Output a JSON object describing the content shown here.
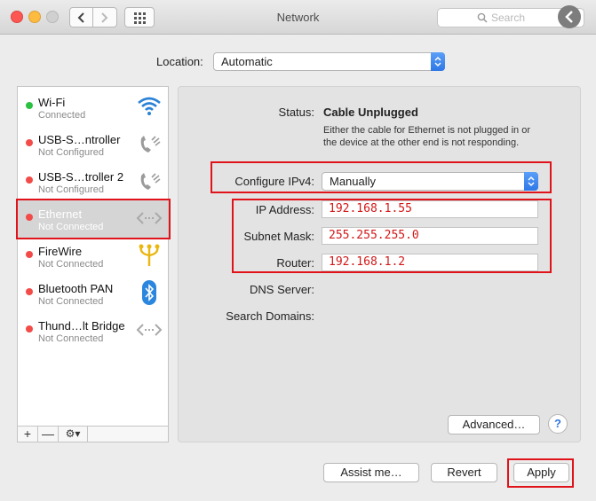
{
  "window": {
    "title": "Network"
  },
  "search": {
    "placeholder": "Search"
  },
  "location": {
    "label": "Location:",
    "value": "Automatic"
  },
  "services": [
    {
      "name": "Wi-Fi",
      "status": "Connected",
      "dot": "#2bc140",
      "icon": "wifi-icon"
    },
    {
      "name": "USB-S…ntroller",
      "status": "Not Configured",
      "dot": "#f24b48",
      "icon": "phone-icon"
    },
    {
      "name": "USB-S…troller 2",
      "status": "Not Configured",
      "dot": "#f24b48",
      "icon": "phone-icon"
    },
    {
      "name": "Ethernet",
      "status": "Not Connected",
      "dot": "#f24b48",
      "icon": "ethernet-icon"
    },
    {
      "name": "FireWire",
      "status": "Not Connected",
      "dot": "#f24b48",
      "icon": "firewire-icon"
    },
    {
      "name": "Bluetooth PAN",
      "status": "Not Connected",
      "dot": "#f24b48",
      "icon": "bluetooth-icon"
    },
    {
      "name": "Thund…lt Bridge",
      "status": "Not Connected",
      "dot": "#f24b48",
      "icon": "ethernet-icon"
    }
  ],
  "sidebar_footer": {
    "add": "+",
    "remove": "—",
    "gear": "⚙▾"
  },
  "detail": {
    "status_label": "Status:",
    "status_value": "Cable Unplugged",
    "status_description": "Either the cable for Ethernet is not plugged in or the device at the other end is not responding.",
    "configure_label": "Configure IPv4:",
    "configure_value": "Manually",
    "ip_label": "IP Address:",
    "ip_value": "192.168.1.55",
    "subnet_label": "Subnet Mask:",
    "subnet_value": "255.255.255.0",
    "router_label": "Router:",
    "router_value": "192.168.1.2",
    "dns_label": "DNS Server:",
    "search_domains_label": "Search Domains:",
    "advanced_button": "Advanced…",
    "help": "?"
  },
  "buttons": {
    "assist": "Assist me…",
    "revert": "Revert",
    "apply": "Apply"
  },
  "colors": {
    "accent": "#2f77e6",
    "highlight_box": "#e0121a",
    "typed_value": "#d31717"
  }
}
